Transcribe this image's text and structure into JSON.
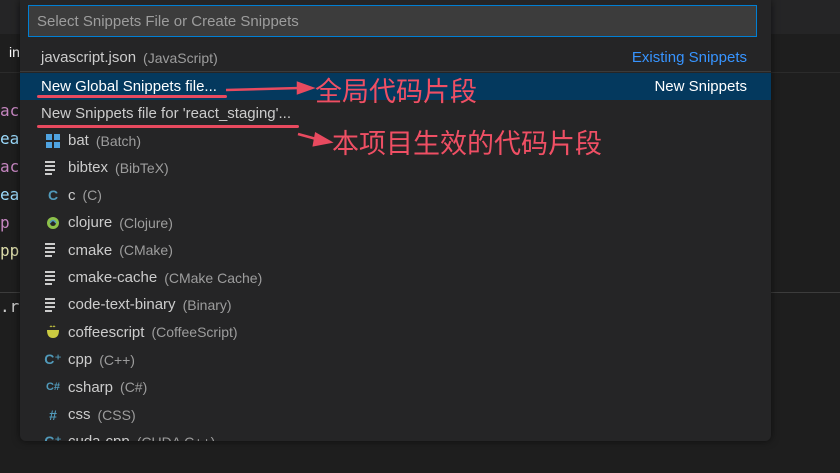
{
  "background": {
    "tab_label": "in",
    "code_lines": [
      {
        "text": "act",
        "color": "#c586c0"
      },
      {
        "text": "eat",
        "color": "#9cdcfe"
      },
      {
        "text": "act",
        "color": "#c586c0"
      },
      {
        "text": "eat",
        "color": "#9cdcfe"
      },
      {
        "text": "p",
        "color": "#c586c0"
      },
      {
        "text": "pp",
        "color": "#dcdcaa"
      }
    ],
    "terminal_text": ".r"
  },
  "quickpick": {
    "placeholder": "Select Snippets File or Create Snippets",
    "existing": {
      "label": "javascript.json",
      "description": "(JavaScript)",
      "group": "Existing Snippets"
    },
    "new_global": {
      "label": "New Global Snippets file...",
      "group": "New Snippets"
    },
    "new_project": {
      "label": "New Snippets file for 'react_staging'..."
    },
    "languages": [
      {
        "icon": "windows-icon",
        "label": "bat",
        "description": "(Batch)"
      },
      {
        "icon": "lines-icon",
        "label": "bibtex",
        "description": "(BibTeX)"
      },
      {
        "icon": "c-icon",
        "label": "c",
        "description": "(C)"
      },
      {
        "icon": "clojure-icon",
        "label": "clojure",
        "description": "(Clojure)"
      },
      {
        "icon": "lines-icon",
        "label": "cmake",
        "description": "(CMake)"
      },
      {
        "icon": "lines-icon",
        "label": "cmake-cache",
        "description": "(CMake Cache)"
      },
      {
        "icon": "lines-icon",
        "label": "code-text-binary",
        "description": "(Binary)"
      },
      {
        "icon": "coffee-icon",
        "label": "coffeescript",
        "description": "(CoffeeScript)"
      },
      {
        "icon": "cpp-icon",
        "label": "cpp",
        "description": "(C++)"
      },
      {
        "icon": "csharp-icon",
        "label": "csharp",
        "description": "(C#)"
      },
      {
        "icon": "hash-icon",
        "label": "css",
        "description": "(CSS)"
      },
      {
        "icon": "cpp-icon",
        "label": "cuda-cpp",
        "description": "(CUDA C++)"
      }
    ]
  },
  "annotations": {
    "global": "全局代码片段",
    "project": "本项目生效的代码片段",
    "color": "#e84a5f"
  }
}
